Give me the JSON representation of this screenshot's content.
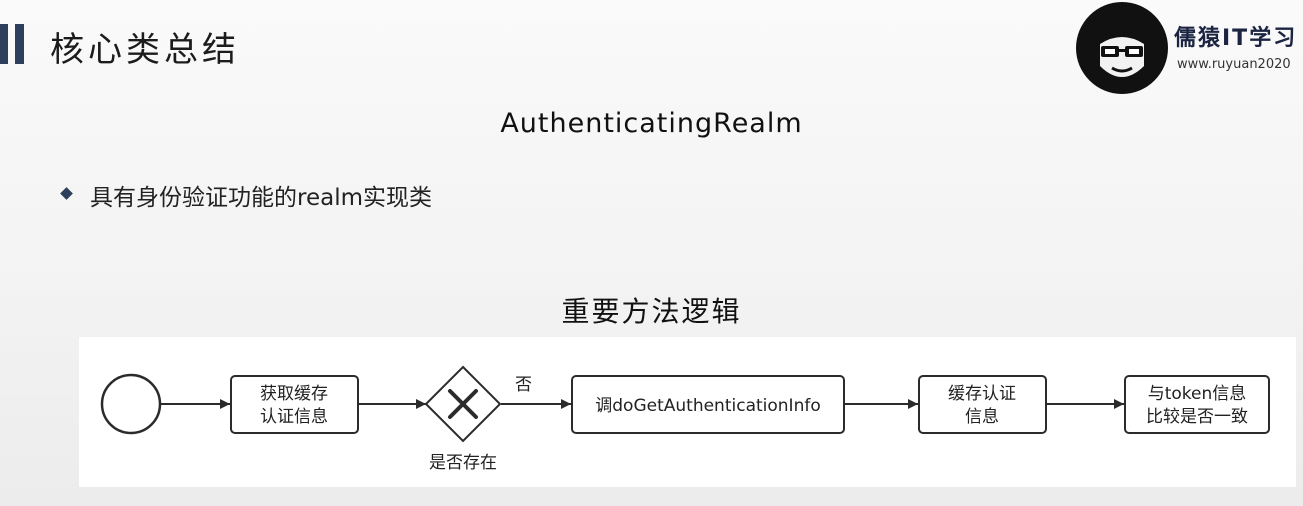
{
  "header": {
    "title": "核心类总结",
    "logo_name": "儒猿IT学习",
    "logo_url": "www.ruyuan2020"
  },
  "content": {
    "class_name": "AuthenticatingRealm",
    "bullet": "具有身份验证功能的realm实现类",
    "section_title": "重要方法逻辑"
  },
  "diagram": {
    "task1": [
      "获取缓存",
      "认证信息"
    ],
    "gateway_label": "是否存在",
    "edge_no_label": "否",
    "task2": "调doGetAuthenticationInfo",
    "task3": [
      "缓存认证",
      "信息"
    ],
    "task4": [
      "与token信息",
      "比较是否一致"
    ]
  },
  "colors": {
    "accent": "#2e3f5c",
    "stroke": "#2b2b2b"
  }
}
